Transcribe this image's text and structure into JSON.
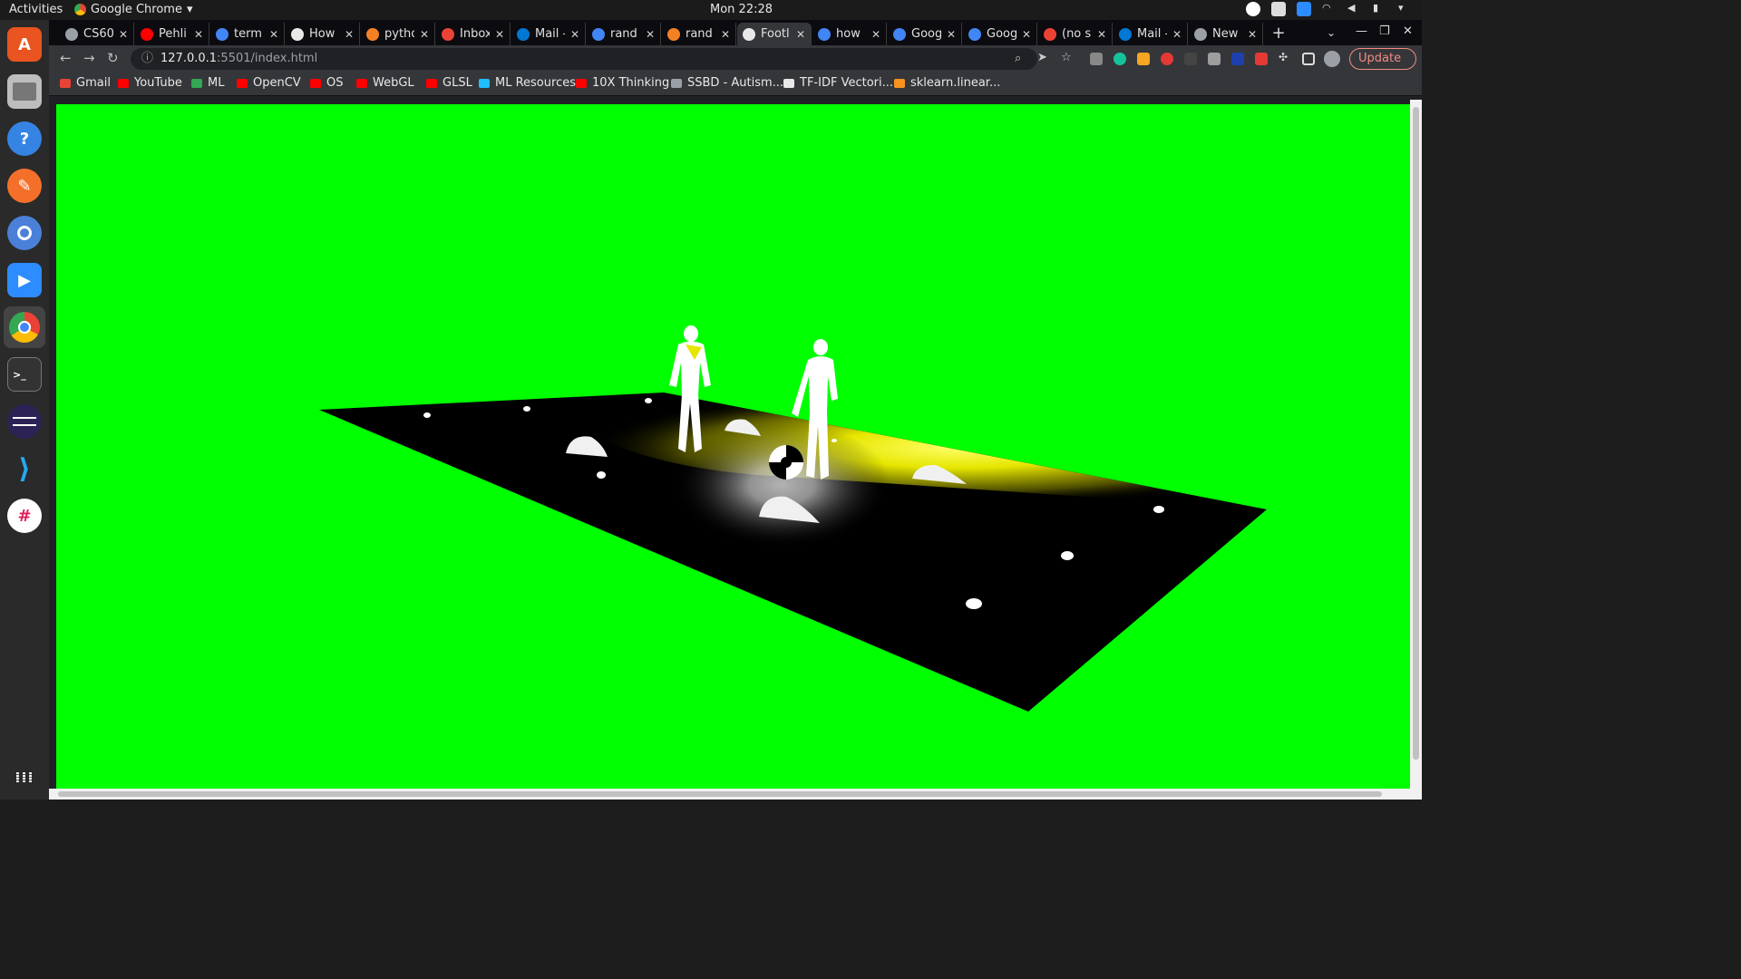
{
  "system_bar": {
    "activities_label": "Activities",
    "app_name": "Google Chrome",
    "clock": "Mon 22:28"
  },
  "dock": {
    "items": [
      "ubuntu-software",
      "files",
      "help",
      "pencil-app",
      "chromium",
      "zoom",
      "google-chrome",
      "terminal",
      "eclipse",
      "vscode",
      "slack"
    ],
    "show_apps_icon": "grid-icon"
  },
  "tabs": [
    {
      "title": "CS60",
      "fav": "#9aa0a6"
    },
    {
      "title": "Pehli",
      "fav": "#ff0000"
    },
    {
      "title": "term",
      "fav": "#4285f4"
    },
    {
      "title": "How",
      "fav": "#e8e8e8"
    },
    {
      "title": "pytho",
      "fav": "#f48024"
    },
    {
      "title": "Inbox",
      "fav": "#ea4335"
    },
    {
      "title": "Mail -",
      "fav": "#0078d4"
    },
    {
      "title": "rand",
      "fav": "#4285f4"
    },
    {
      "title": "rand",
      "fav": "#f48024"
    },
    {
      "title": "Footl",
      "fav": "#e8e8e8",
      "active": true
    },
    {
      "title": "how",
      "fav": "#4285f4"
    },
    {
      "title": "Goog",
      "fav": "#4285f4"
    },
    {
      "title": "Goog",
      "fav": "#4285f4"
    },
    {
      "title": "(no s",
      "fav": "#ea4335"
    },
    {
      "title": "Mail -",
      "fav": "#0078d4"
    },
    {
      "title": "New",
      "fav": "#9aa0a6"
    }
  ],
  "toolbar": {
    "url_host": "127.0.0.1",
    "url_path": ":5501/index.html",
    "update_label": "Update"
  },
  "bookmarks": [
    {
      "label": "Gmail",
      "color": "#ea4335"
    },
    {
      "label": "YouTube",
      "color": "#ff0000"
    },
    {
      "label": "ML",
      "color": "#34a853"
    },
    {
      "label": "OpenCV",
      "color": "#ff0000"
    },
    {
      "label": "OS",
      "color": "#ff0000"
    },
    {
      "label": "WebGL",
      "color": "#ff0000"
    },
    {
      "label": "GLSL",
      "color": "#ff0000"
    },
    {
      "label": "ML Resources",
      "color": "#20beff"
    },
    {
      "label": "10X Thinking",
      "color": "#ff0000"
    },
    {
      "label": "SSBD - Autism...",
      "color": "#9aa0a6"
    },
    {
      "label": "TF-IDF Vectori...",
      "color": "#e8e8e8"
    },
    {
      "label": "sklearn.linear...",
      "color": "#f7931e"
    }
  ],
  "scene": {
    "background": "#00ff00",
    "spotlight_color": "#ffff00",
    "field_color": "#000000"
  }
}
